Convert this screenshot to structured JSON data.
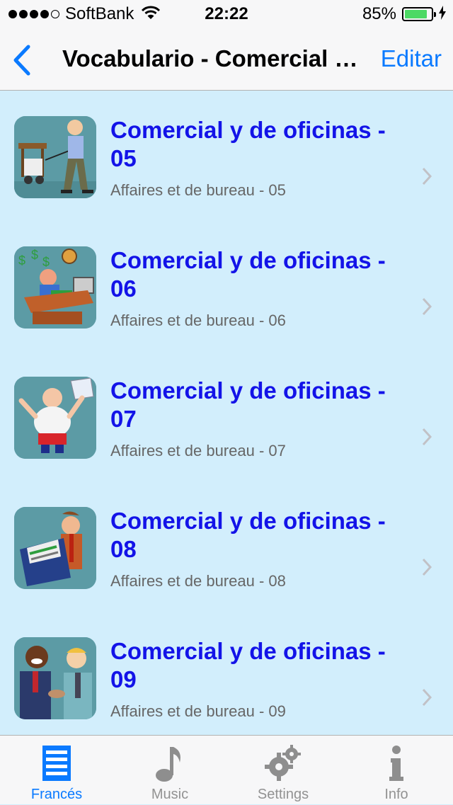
{
  "status_bar": {
    "carrier": "SoftBank",
    "time": "22:22",
    "battery": "85%",
    "battery_level": 0.85
  },
  "nav": {
    "title": "Vocabulario - Comercial y de oficinas",
    "edit_label": "Editar",
    "back_icon": "chevron-left-icon"
  },
  "items": [
    {
      "title": "Comercial y de oficinas - 05",
      "subtitle": "Affaires et de bureau - 05"
    },
    {
      "title": "Comercial y de oficinas - 06",
      "subtitle": "Affaires et de bureau - 06"
    },
    {
      "title": "Comercial y de oficinas - 07",
      "subtitle": "Affaires et de bureau - 07"
    },
    {
      "title": "Comercial y de oficinas - 08",
      "subtitle": "Affaires et de bureau - 08"
    },
    {
      "title": "Comercial y de oficinas - 09",
      "subtitle": "Affaires et de bureau - 09"
    }
  ],
  "tabs": [
    {
      "label": "Francés",
      "icon": "list-icon",
      "active": true
    },
    {
      "label": "Music",
      "icon": "music-note-icon",
      "active": false
    },
    {
      "label": "Settings",
      "icon": "gears-icon",
      "active": false
    },
    {
      "label": "Info",
      "icon": "info-icon",
      "active": false
    }
  ],
  "colors": {
    "accent": "#0a7aff",
    "item_title": "#1313e8",
    "list_background": "#d2eefc",
    "battery_fill": "#4cd964"
  }
}
